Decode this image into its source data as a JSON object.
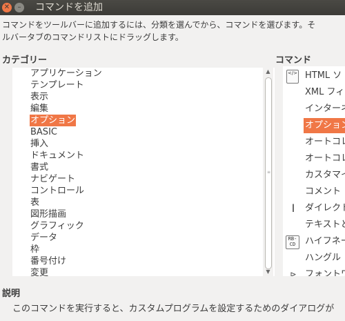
{
  "window": {
    "title": "コマンドを追加"
  },
  "description": {
    "line1": "コマンドをツールバーに追加するには、分類を選んでから、コマンドを選びます。そ",
    "line2": "ルバータブのコマンドリストにドラッグします。"
  },
  "category": {
    "heading": "カテゴリー",
    "items": [
      "アプリケーション",
      "テンプレート",
      "表示",
      "編集",
      "オプション",
      "BASIC",
      "挿入",
      "ドキュメント",
      "書式",
      "ナビゲート",
      "コントロール",
      "表",
      "図形描画",
      "グラフィック",
      "データ",
      "枠",
      "番号付け",
      "変更"
    ],
    "selected": "オプション"
  },
  "commands": {
    "heading": "コマンド",
    "items": [
      {
        "label": "HTML ソ",
        "icon": "html-source-icon"
      },
      {
        "label": "XML フィ",
        "icon": ""
      },
      {
        "label": "インターネ",
        "icon": ""
      },
      {
        "label": "オプション",
        "icon": "",
        "selected": true
      },
      {
        "label": "オートコレ",
        "icon": ""
      },
      {
        "label": "オートコレ",
        "icon": ""
      },
      {
        "label": "カスタマイ",
        "icon": ""
      },
      {
        "label": "コメント",
        "icon": ""
      },
      {
        "label": "ダイレクト",
        "icon": "text-cursor-icon"
      },
      {
        "label": "テキストと",
        "icon": ""
      },
      {
        "label": "ハイフネー",
        "icon": "hyphenation-icon"
      },
      {
        "label": "ハングル",
        "icon": ""
      },
      {
        "label": "フォントワ",
        "icon": "fontwork-icon"
      }
    ]
  },
  "explanation": {
    "heading": "説明",
    "text": "このコマンドを実行すると、カスタムプログラムを設定するためのダイアログが"
  }
}
